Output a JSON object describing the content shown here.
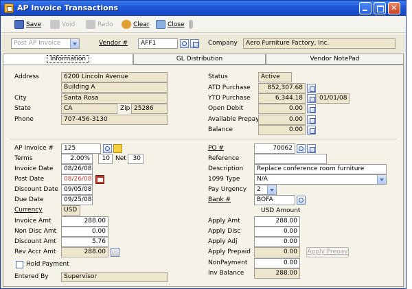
{
  "window": {
    "title": "AP Invoice Transactions"
  },
  "toolbar": {
    "save": "Save",
    "void": "Void",
    "redo": "Redo",
    "clear": "Clear",
    "close": "Close"
  },
  "header": {
    "transaction_type": "Post AP Invoice",
    "vendor_label": "Vendor #",
    "vendor_value": "AFF1",
    "company_label": "Company",
    "company_value": "Aero Furniture Factory, Inc."
  },
  "tabs": [
    "Information",
    "GL Distribution",
    "Vendor NotePad"
  ],
  "vendor": {
    "address_label": "Address",
    "address1": "6200 Lincoln Avenue",
    "address2": "Building A",
    "city_label": "City",
    "city": "Santa Rosa",
    "state_label": "State",
    "state": "CA",
    "zip_label": "Zip",
    "zip": "25286",
    "phone_label": "Phone",
    "phone": "707-456-3130"
  },
  "vendor_status": {
    "status_label": "Status",
    "status": "Active",
    "atd_label": "ATD Purchase",
    "atd": "852,307.68",
    "ytd_label": "YTD Purchase",
    "ytd": "6,344.18",
    "ytd_date": "01/01/08",
    "open_debit_label": "Open Debit",
    "open_debit": "0.00",
    "avail_prepay_label": "Available Prepay",
    "avail_prepay": "0.00",
    "balance_label": "Balance",
    "balance": "0.00"
  },
  "invoice": {
    "invoice_no_label": "AP Invoice #",
    "invoice_no": "125",
    "terms_label": "Terms",
    "terms_pct": "2.00%",
    "terms_days": "10",
    "net_label": "Net",
    "net_days": "30",
    "invoice_date_label": "Invoice Date",
    "invoice_date": "08/26/08",
    "post_date_label": "Post Date",
    "post_date": "08/26/08",
    "discount_date_label": "Discount Date",
    "discount_date": "09/05/08",
    "due_date_label": "Due Date",
    "due_date": "09/25/08",
    "currency_label": "Currency",
    "currency": "USD",
    "invoice_amt_label": "Invoice Amt",
    "invoice_amt": "288.00",
    "non_disc_amt_label": "Non Disc Amt",
    "non_disc_amt": "0.00",
    "discount_amt_label": "Discount Amt",
    "discount_amt": "5.76",
    "rev_accr_amt_label": "Rev Accr Amt",
    "rev_accr_amt": "288.00",
    "hold_payment_label": "Hold Payment",
    "entered_by_label": "Entered By",
    "entered_by": "Supervisor"
  },
  "po": {
    "po_label": "PO #",
    "po": "70062",
    "reference_label": "Reference",
    "reference": "",
    "description_label": "Description",
    "description": "Replace conference room furniture",
    "type_1099_label": "1099 Type",
    "type_1099": "N/A",
    "pay_urgency_label": "Pay Urgency",
    "pay_urgency": "2",
    "bank_label": "Bank #",
    "bank": "BOFA"
  },
  "apply": {
    "usd_amount_label": "USD Amount",
    "apply_amt_label": "Apply Amt",
    "apply_amt": "288.00",
    "apply_disc_label": "Apply Disc",
    "apply_disc": "0.00",
    "apply_adj_label": "Apply Adj",
    "apply_adj": "0.00",
    "apply_prepaid_label": "Apply Prepaid",
    "apply_prepaid": "0.00",
    "apply_prepay_button": "Apply Prepay",
    "nonpayment_label": "NonPayment",
    "nonpayment": "0.00",
    "inv_balance_label": "Inv Balance",
    "inv_balance": "288.00"
  }
}
